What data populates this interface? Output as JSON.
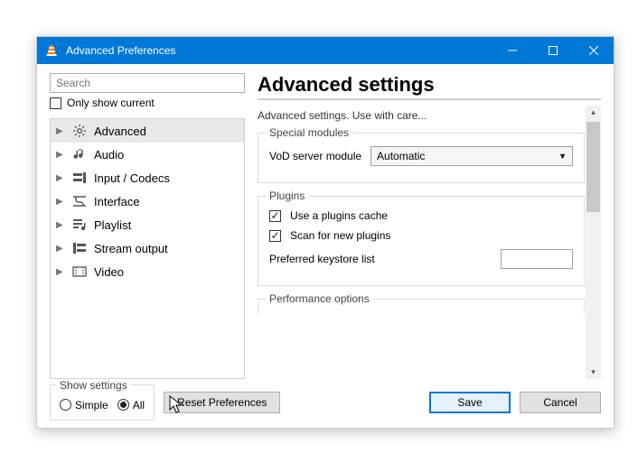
{
  "window": {
    "title": "Advanced Preferences"
  },
  "search": {
    "placeholder": "Search"
  },
  "only_show_current": "Only show current",
  "tree": {
    "items": [
      {
        "label": "Advanced"
      },
      {
        "label": "Audio"
      },
      {
        "label": "Input / Codecs"
      },
      {
        "label": "Interface"
      },
      {
        "label": "Playlist"
      },
      {
        "label": "Stream output"
      },
      {
        "label": "Video"
      }
    ]
  },
  "content": {
    "heading": "Advanced settings",
    "subtitle": "Advanced settings. Use with care...",
    "special": {
      "legend": "Special modules",
      "vod_label": "VoD server module",
      "vod_value": "Automatic"
    },
    "plugins": {
      "legend": "Plugins",
      "use_cache": "Use a plugins cache",
      "scan_new": "Scan for new plugins",
      "keystore_label": "Preferred keystore list"
    },
    "performance": {
      "legend": "Performance options"
    }
  },
  "bottom": {
    "show_settings": "Show settings",
    "simple": "Simple",
    "all": "All",
    "reset": "Reset Preferences",
    "save": "Save",
    "cancel": "Cancel"
  }
}
